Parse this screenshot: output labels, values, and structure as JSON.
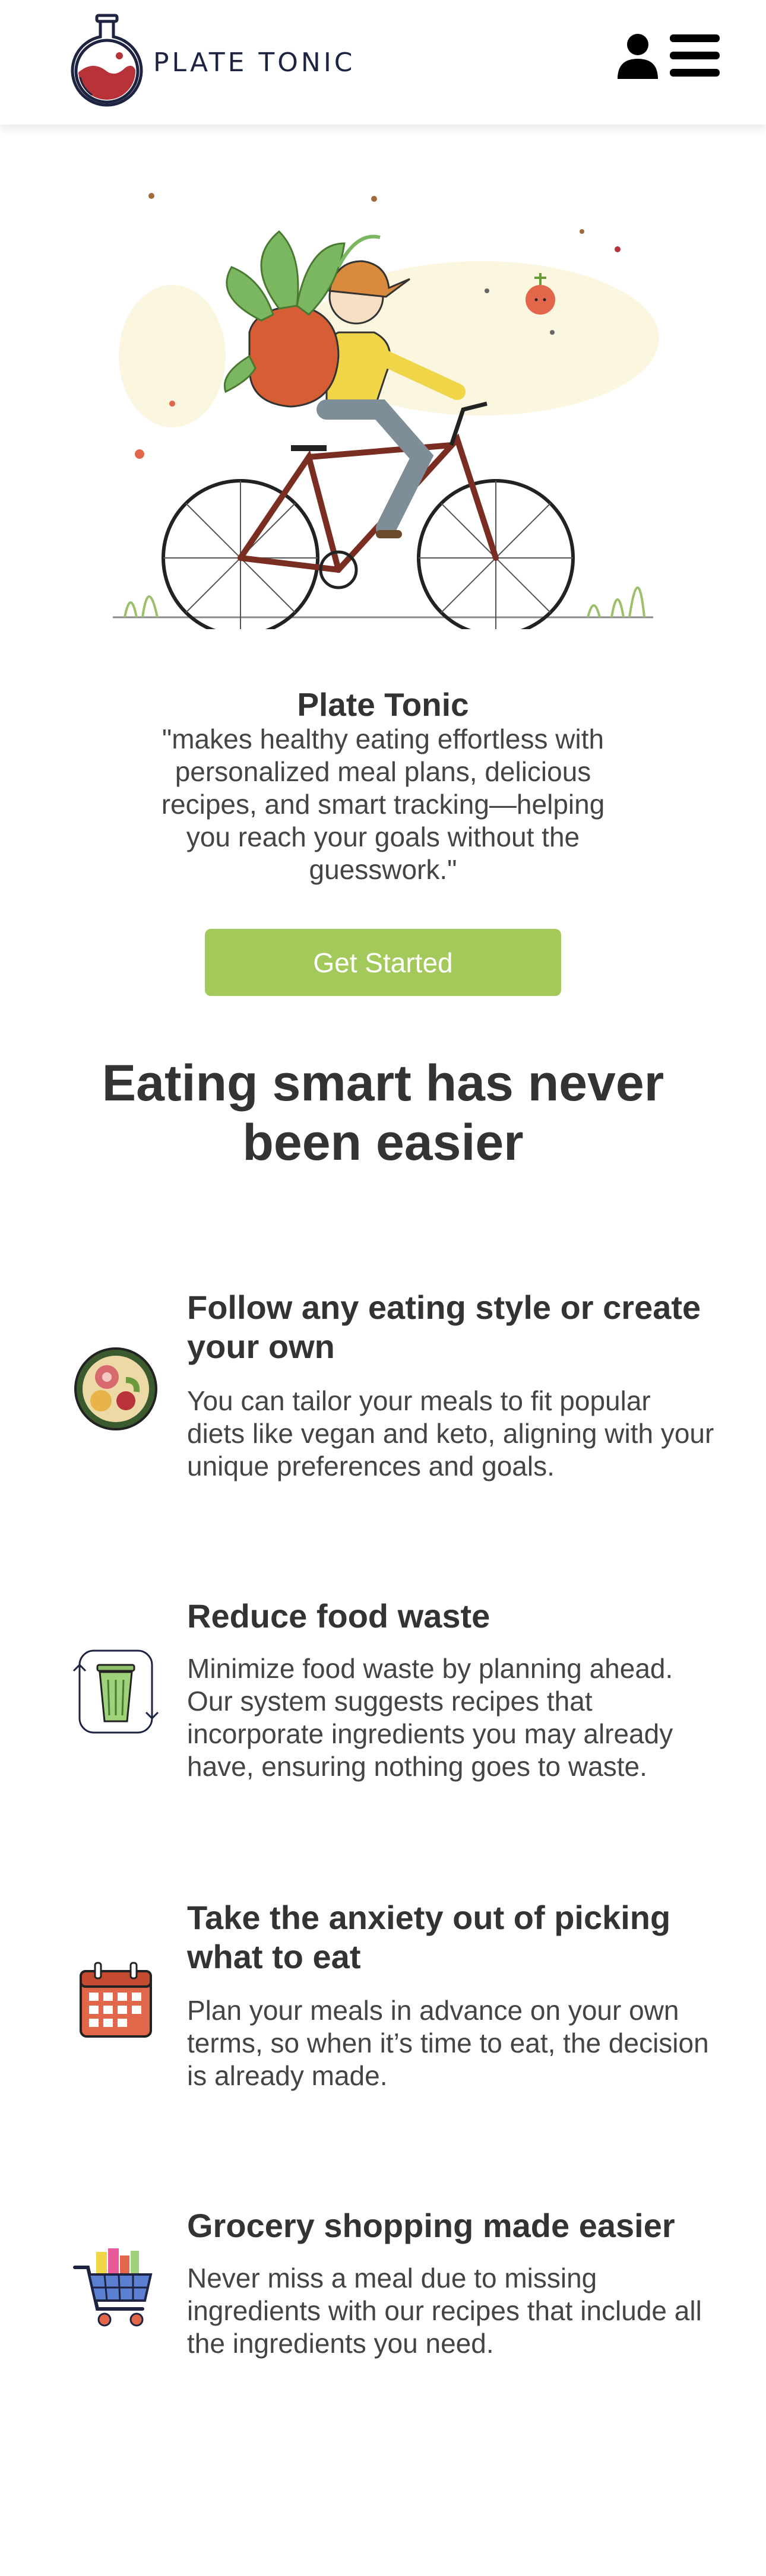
{
  "header": {
    "brand": "PLATE TONIC",
    "icons": [
      "logo-flask-icon",
      "user-icon",
      "hamburger-menu-icon"
    ]
  },
  "hero": {
    "illustration": "cyclist-with-vegetables-illustration",
    "name": "Plate Tonic",
    "quote": "\"makes healthy eating effortless with personalized meal plans, delicious recipes, and smart tracking—helping you reach your goals without the guesswork.\"",
    "cta_label": "Get Started"
  },
  "section_title": "Eating smart has never been easier",
  "features": [
    {
      "icon": "diet-plate-icon",
      "title": "Follow any eating style or create your own",
      "description": "You can tailor your meals to fit popular diets like vegan and keto, aligning with your unique preferences and goals."
    },
    {
      "icon": "recycle-bin-icon",
      "title": "Reduce food waste",
      "description": "Minimize food waste by planning ahead. Our system suggests recipes that incorporate ingredients you may already have, ensuring nothing goes to waste."
    },
    {
      "icon": "calendar-icon",
      "title": "Take the anxiety out of picking what to eat",
      "description": "Plan your meals in advance on your own terms, so when it’s time to eat, the decision is already made."
    },
    {
      "icon": "shopping-cart-icon",
      "title": "Grocery shopping made easier",
      "description": "Never miss a meal due to missing ingredients with our recipes that include all the ingredients you need."
    }
  ],
  "colors": {
    "cta": "#a4c95b",
    "brand_navy": "#1d2340",
    "logo_red": "#b8323a",
    "text": "#333333"
  }
}
